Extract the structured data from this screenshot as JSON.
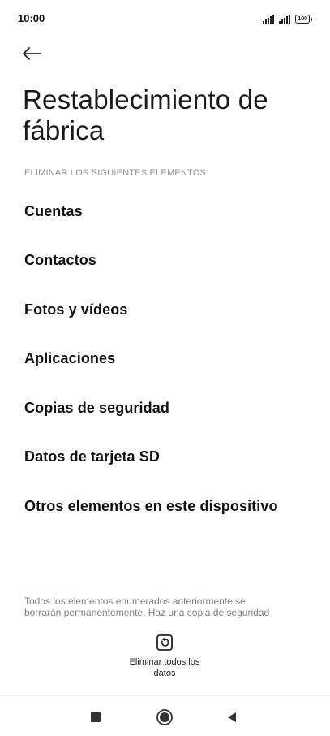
{
  "status_bar": {
    "time": "10:00",
    "battery_level": "100"
  },
  "header": {
    "back_icon": "arrow-left-icon",
    "title": "Restablecimiento de fábrica"
  },
  "section": {
    "label": "ELIMINAR LOS SIGUIENTES ELEMENTOS",
    "items": [
      {
        "label": "Cuentas"
      },
      {
        "label": "Contactos"
      },
      {
        "label": "Fotos y vídeos"
      },
      {
        "label": "Aplicaciones"
      },
      {
        "label": "Copias de seguridad"
      },
      {
        "label": "Datos de tarjeta SD"
      },
      {
        "label": "Otros elementos en este dispositivo"
      }
    ]
  },
  "footer": {
    "note": "Todos los elementos enumerados anteriormente se\nborrarán permanentemente. Haz una copia de seguridad",
    "action_label": "Eliminar todos los datos",
    "action_icon": "reset-icon"
  },
  "nav_bar": {
    "recents_icon": "square-icon",
    "home_icon": "circle-icon",
    "back_icon": "triangle-back-icon"
  }
}
